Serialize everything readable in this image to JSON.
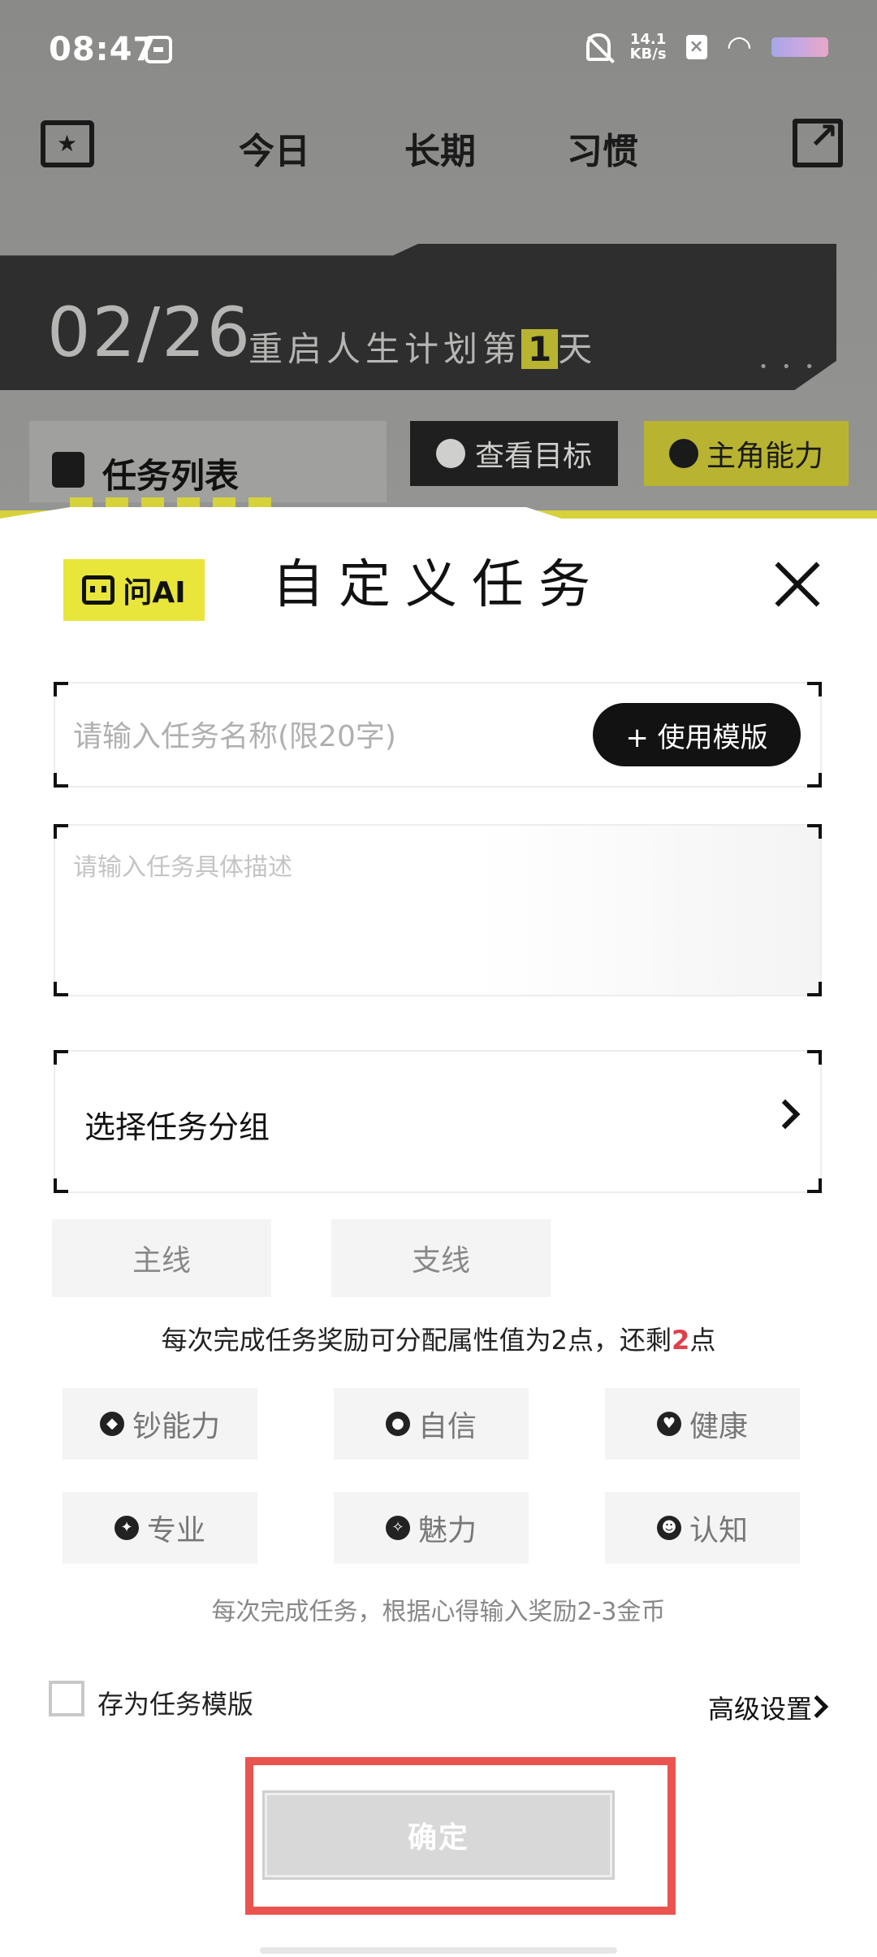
{
  "status_bar": {
    "time": "08:47",
    "net_speed_value": "14.1",
    "net_speed_unit": "KB/s"
  },
  "top_nav": {
    "tabs": [
      "今日",
      "长期",
      "习惯"
    ],
    "active_tab": "今日"
  },
  "banner": {
    "date": "02/26",
    "text_prefix": "重启人生计划第",
    "day": "1",
    "text_suffix": "天"
  },
  "task_section": {
    "title": "任务列表",
    "view_goals_label": "查看目标",
    "abilities_label": "主角能力"
  },
  "modal": {
    "ai_label": "问AI",
    "title": "自定义任务",
    "name_placeholder": "请输入任务名称(限20字)",
    "name_value": "",
    "use_template_label": "+ 使用模版",
    "desc_placeholder": "请输入任务具体描述",
    "desc_value": "",
    "group_label": "选择任务分组",
    "line_options": [
      "主线",
      "支线"
    ],
    "reward_hint_prefix": "每次完成任务奖励可分配属性值为2点，还剩",
    "reward_remaining": "2",
    "reward_hint_suffix": "点",
    "attributes": [
      {
        "label": "钞能力",
        "icon": "diamond-icon"
      },
      {
        "label": "自信",
        "icon": "lightbulb-icon"
      },
      {
        "label": "健康",
        "icon": "heart-pulse-icon"
      },
      {
        "label": "专业",
        "icon": "compass-icon"
      },
      {
        "label": "魅力",
        "icon": "magic-wand-icon"
      },
      {
        "label": "认知",
        "icon": "brain-head-icon"
      }
    ],
    "coin_hint": "每次完成任务，根据心得输入奖励2-3金币",
    "save_template_label": "存为任务模版",
    "save_template_checked": false,
    "advanced_label": "高级设置",
    "confirm_label": "确定"
  },
  "colors": {
    "accent_yellow": "#e8e63a",
    "highlight_red": "#ea5450",
    "dark": "#121212"
  }
}
